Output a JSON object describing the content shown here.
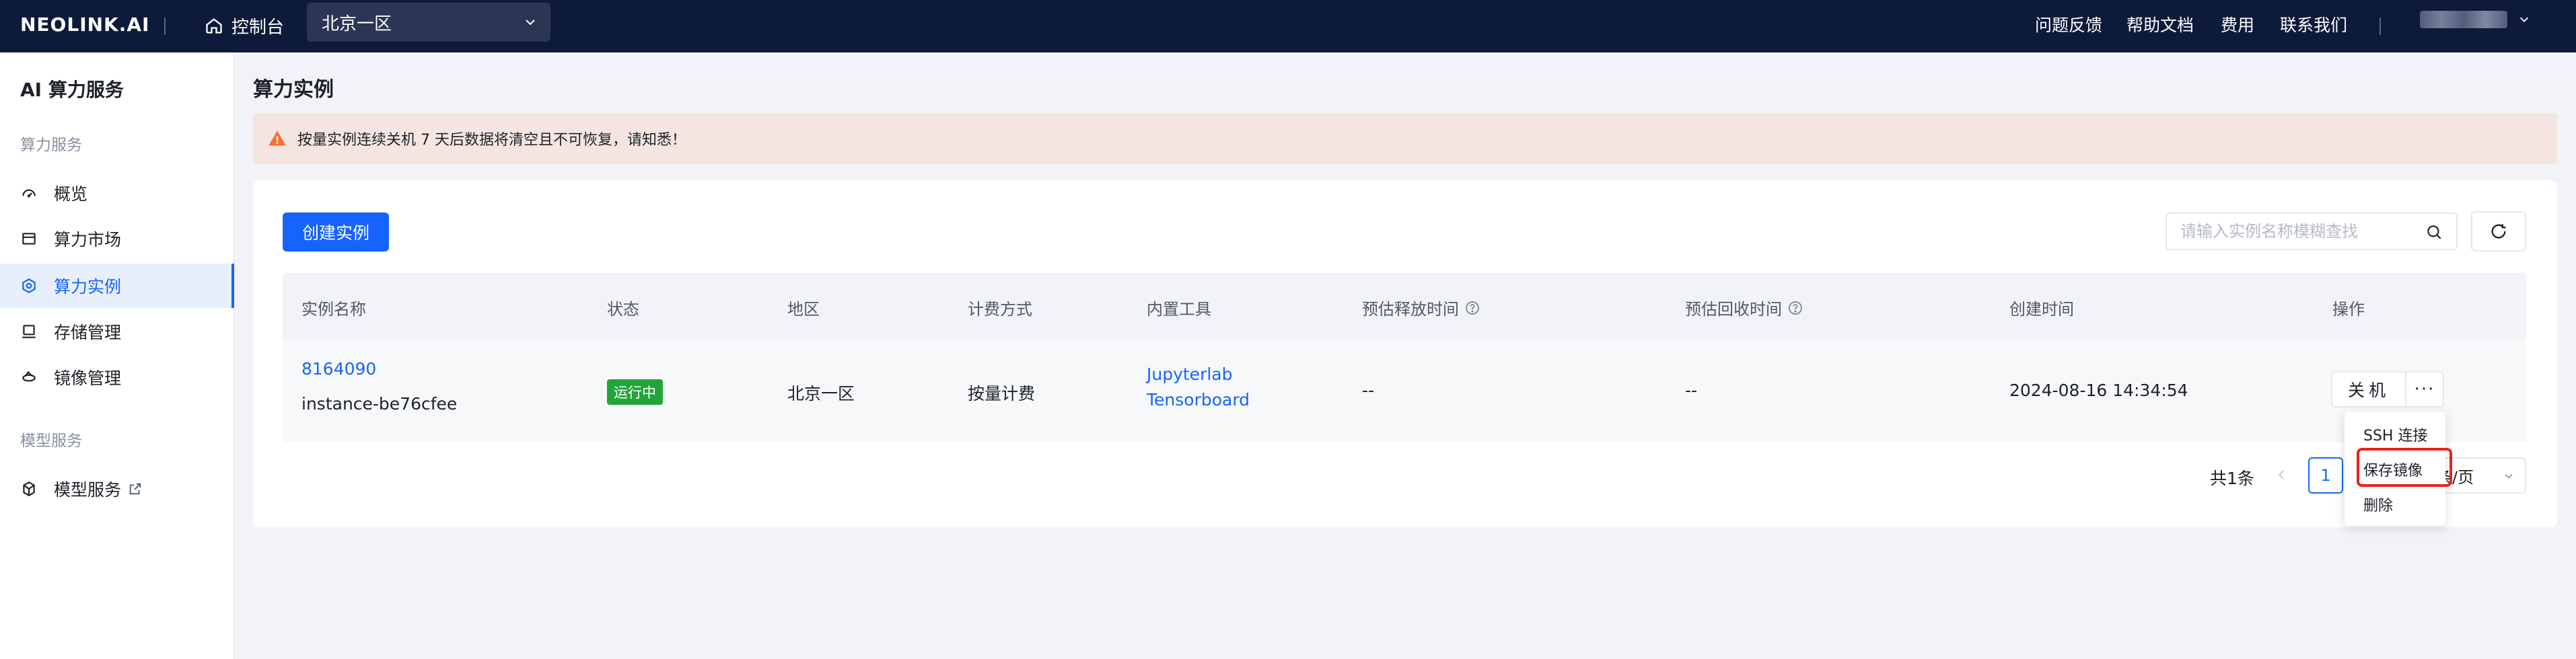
{
  "topbar": {
    "logo": "NEOLINK.AI",
    "console": "控制台",
    "region": "北京一区",
    "links": [
      "问题反馈",
      "帮助文档",
      "费用",
      "联系我们"
    ]
  },
  "sidebar": {
    "title": "AI 算力服务",
    "group1": "算力服务",
    "items": [
      {
        "label": "概览",
        "icon": "dashboard-icon"
      },
      {
        "label": "算力市场",
        "icon": "market-icon"
      },
      {
        "label": "算力实例",
        "icon": "instance-icon"
      },
      {
        "label": "存储管理",
        "icon": "storage-icon"
      },
      {
        "label": "镜像管理",
        "icon": "image-icon"
      }
    ],
    "group2": "模型服务",
    "model_item": {
      "label": "模型服务",
      "icon": "cube-icon"
    }
  },
  "main": {
    "page_title": "算力实例",
    "alert": "按量实例连续关机 7 天后数据将清空且不可恢复，请知悉！",
    "create_button": "创建实例",
    "search_placeholder": "请输入实例名称模糊查找"
  },
  "table": {
    "headers": {
      "name": "实例名称",
      "status": "状态",
      "region": "地区",
      "billing": "计费方式",
      "tools": "内置工具",
      "release": "预估释放时间",
      "reclaim": "预估回收时间",
      "created": "创建时间",
      "actions": "操作"
    },
    "row": {
      "id": "8164090",
      "name": "instance-be76cfee",
      "status": "运行中",
      "region": "北京一区",
      "billing": "按量计费",
      "tool1": "Jupyterlab",
      "tool2": "Tensorboard",
      "release": "--",
      "reclaim": "--",
      "created": "2024-08-16 14:34:54",
      "shutdown": "关机",
      "more": "···"
    }
  },
  "pagination": {
    "total": "共1条",
    "current_page": "1",
    "page_size": "条/页"
  },
  "dropdown": {
    "items": [
      "SSH 连接",
      "保存镜像",
      "删除"
    ]
  },
  "colors": {
    "primary": "#1664ff",
    "topbar": "#0e1a3a",
    "running": "#23a43b",
    "highlight": "#e8231a"
  }
}
